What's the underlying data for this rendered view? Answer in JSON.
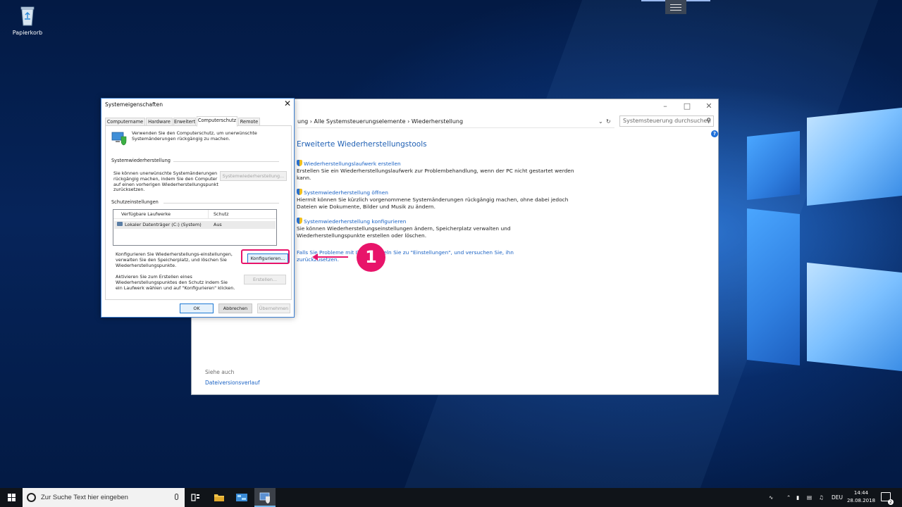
{
  "desktop": {
    "icons": [
      {
        "label": "Papierkorb",
        "icon": "recycle-bin-icon"
      }
    ]
  },
  "control_panel": {
    "breadcrumb": [
      "ung",
      "Alle Systemsteuerungselemente",
      "Wiederherstellung"
    ],
    "search_placeholder": "Systemsteuerung durchsuchen",
    "heading": "Erweiterte Wiederherstellungstools",
    "tools": [
      {
        "link": "Wiederherstellungslaufwerk erstellen",
        "desc": "Erstellen Sie ein Wiederherstellungslaufwerk zur Problembehandlung, wenn der PC nicht gestartet werden kann."
      },
      {
        "link": "Systemwiederherstellung öffnen",
        "desc": "Hiermit können Sie kürzlich vorgenommene Systemänderungen rückgängig machen, ohne dabei jedoch Dateien wie Dokumente, Bilder und Musik zu ändern."
      },
      {
        "link": "Systemwiederherstellung konfigurieren",
        "desc": "Sie können Wiederherstellungseinstellungen ändern, Speicherplatz verwalten und Wiederherstellungspunkte erstellen oder löschen."
      }
    ],
    "trouble_text": "Falls Sie Probleme mit Ih… wechseln Sie zu \"Einstellungen\", und versuchen Sie, ihn zurückzusetzen.",
    "see_also": "Siehe auch",
    "see_also_link": "Dateiversionsverlauf"
  },
  "dialog": {
    "title": "Systemeigenschaften",
    "tabs": [
      "Computername",
      "Hardware",
      "Erweitert",
      "Computerschutz",
      "Remote"
    ],
    "active_tab": "Computerschutz",
    "intro": "Verwenden Sie den Computerschutz, um unerwünschte Systemänderungen rückgängig zu machen.",
    "restore_group": "Systemwiederherstellung",
    "restore_text": "Sie können unerwünschte Systemänderungen rückgängig machen, indem Sie den Computer auf einen vorherigen Wiederherstellungspunkt zurücksetzen.",
    "restore_button": "Systemwiederherstellung...",
    "protection_group": "Schutzeinstellungen",
    "col_drives": "Verfügbare Laufwerke",
    "col_protection": "Schutz",
    "drive_name": "Lokaler Datenträger (C:) (System)",
    "drive_status": "Aus",
    "configure_text": "Konfigurieren Sie Wiederherstellungs-einstellungen, verwalten Sie den Speicherplatz, und löschen Sie Wiederherstellungspunkte.",
    "configure_button": "Konfigurieren...",
    "create_text": "Aktivieren Sie zum Erstellen eines Wiederherstellungspunktes den Schutz indem Sie ein Laufwerk wählen und auf \"Konfigurieren\" klicken.",
    "create_button": "Erstellen...",
    "ok": "OK",
    "cancel": "Abbrechen",
    "apply": "Übernehmen"
  },
  "annotation": {
    "number": "1",
    "color": "#e8146a"
  },
  "taskbar": {
    "search_text": "Zur Suche Text hier eingeben",
    "language": "DEU",
    "time": "14:44",
    "date": "28.08.2018",
    "notifications": "2"
  }
}
